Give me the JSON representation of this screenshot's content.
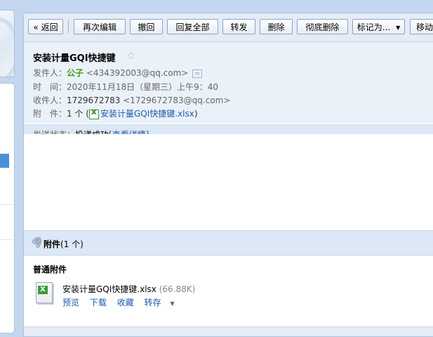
{
  "toolbar": {
    "back": "« 返回",
    "reedit": "再次编辑",
    "recall": "撤回",
    "reply_all": "回复全部",
    "forward": "转发",
    "delete": "删除",
    "delete_forever": "彻底删除",
    "mark_as": "标记为...",
    "move_to": "移动到"
  },
  "email": {
    "subject": "安装计量GQI快捷键",
    "star_icon": "star-outline-icon",
    "from_label": "发件人：",
    "from_name": "公子",
    "from_address": "<434392003@qq.com>",
    "time_label": "时　间：",
    "time_value": "2020年11月18日（星期三）上午9：40",
    "to_label": "收件人：",
    "to_name": "1729672783",
    "to_address": "<1729672783@qq.com>",
    "attachment_label": "附　件：",
    "attachment_count": "1 个",
    "attachment_link": "安装计量GQI快捷键.xlsx",
    "send_status_label": "发送状态：",
    "send_status_value": "投递成功",
    "view_details": "[查看详情]"
  },
  "attachments": {
    "title": "附件",
    "count": "(1 个)",
    "group_label": "普通附件",
    "items": [
      {
        "name": "安装计量GQI快捷键.xlsx",
        "size": "(66.88K)",
        "actions": [
          "预览",
          "下载",
          "收藏",
          "转存"
        ]
      }
    ]
  },
  "colors": {
    "background": "#c3d6ed",
    "header_bg": "#eaf1f9",
    "sender_green": "#3c9e1f",
    "link_blue": "#1e5aa8"
  }
}
